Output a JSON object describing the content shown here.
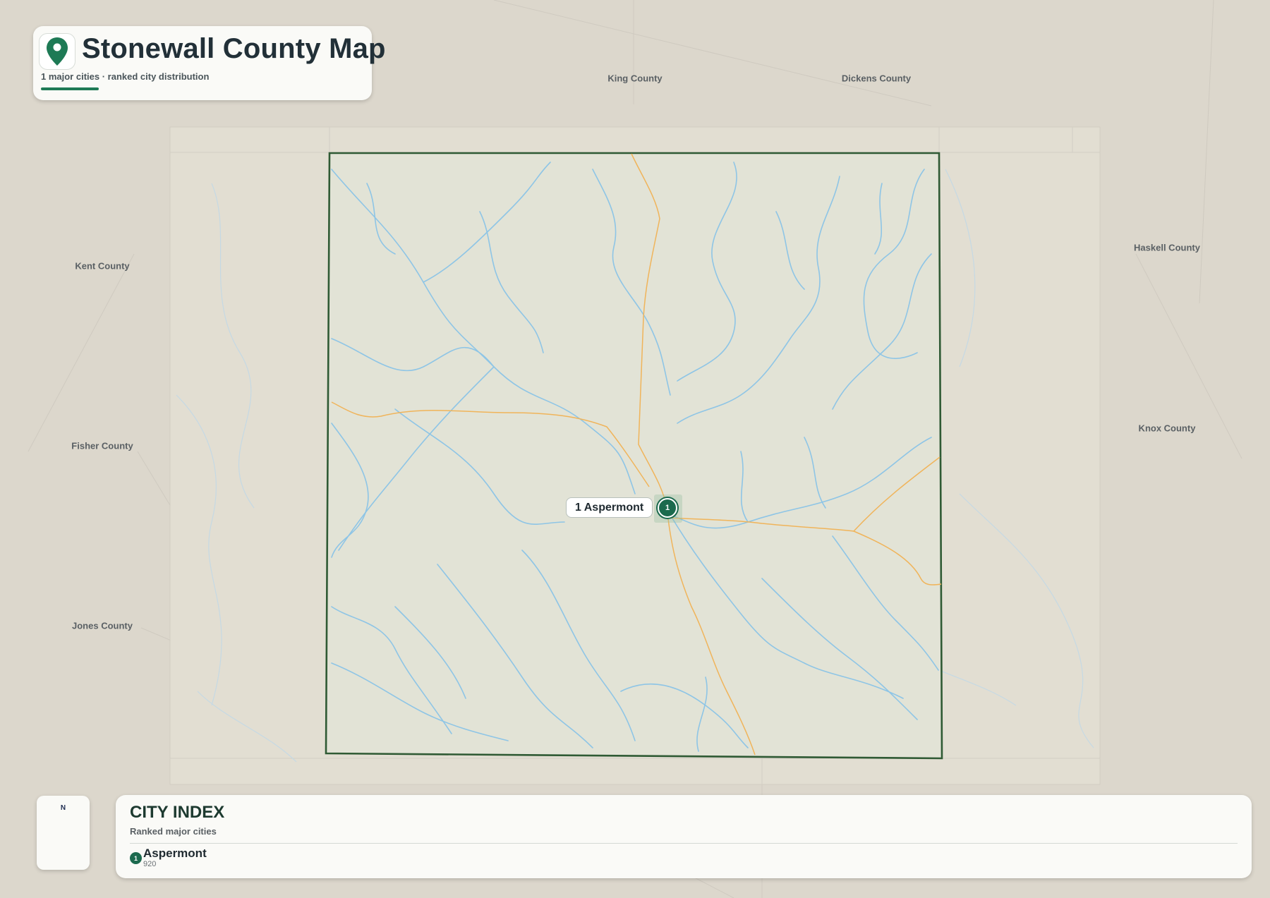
{
  "header": {
    "title": "Stonewall County Map",
    "subtitle": "1 major cities · ranked city distribution",
    "icon": "map-pin-icon"
  },
  "neighbors": [
    {
      "id": "king",
      "name": "King County"
    },
    {
      "id": "dickens",
      "name": "Dickens County"
    },
    {
      "id": "kent",
      "name": "Kent County"
    },
    {
      "id": "haskell",
      "name": "Haskell County"
    },
    {
      "id": "fisher",
      "name": "Fisher County"
    },
    {
      "id": "knox",
      "name": "Knox County"
    },
    {
      "id": "jones",
      "name": "Jones County"
    }
  ],
  "cities": [
    {
      "rank": "1",
      "name": "Aspermont",
      "value": "920",
      "map_label": "1 Aspermont"
    }
  ],
  "compass": {
    "north_label": "N"
  },
  "city_index": {
    "title": "CITY INDEX",
    "subtitle": "Ranked major cities"
  },
  "colors": {
    "background": "#dcd7cc",
    "county_fill": "#e2e3d6",
    "county_border": "#2f5a34",
    "rivers": "#8ec5e6",
    "roads": "#f0b45a",
    "accent": "#1c6a4e"
  }
}
